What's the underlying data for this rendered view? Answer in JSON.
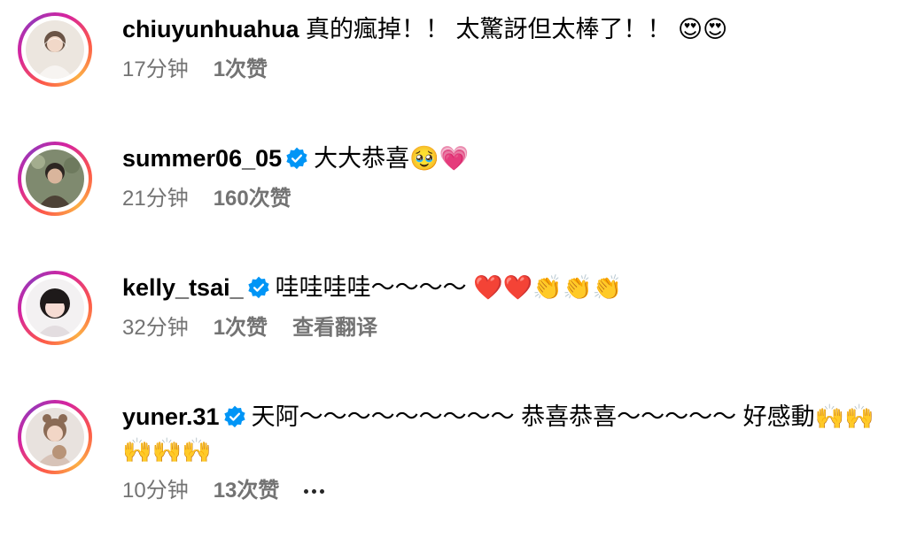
{
  "comments": [
    {
      "username": "chiuyunhuahua",
      "verified": false,
      "text": "真的瘋掉！！ 太驚訝但太棒了！！ 😍😍",
      "time": "17分钟",
      "likes": "1次赞",
      "translate": "",
      "more": false
    },
    {
      "username": "summer06_05",
      "verified": true,
      "text": "大大恭喜🥹💗",
      "time": "21分钟",
      "likes": "160次赞",
      "translate": "",
      "more": false
    },
    {
      "username": "kelly_tsai_",
      "verified": true,
      "text": "哇哇哇哇～～～～ ❤️❤️👏👏👏",
      "time": "32分钟",
      "likes": "1次赞",
      "translate": "查看翻译",
      "more": false
    },
    {
      "username": "yuner.31",
      "verified": true,
      "text": "天阿～～～～～～～～～ 恭喜恭喜～～～～～ 好感動🙌🙌🙌🙌🙌",
      "time": "10分钟",
      "likes": "13次赞",
      "translate": "",
      "more": true
    }
  ],
  "colors": {
    "meta_text": "#737373",
    "verified_badge": "#0095f6",
    "ring_start": "#fcaf45",
    "ring_end": "#d6249f"
  },
  "icons": {
    "verified": "verified-badge-icon",
    "more": "more-options-icon"
  }
}
